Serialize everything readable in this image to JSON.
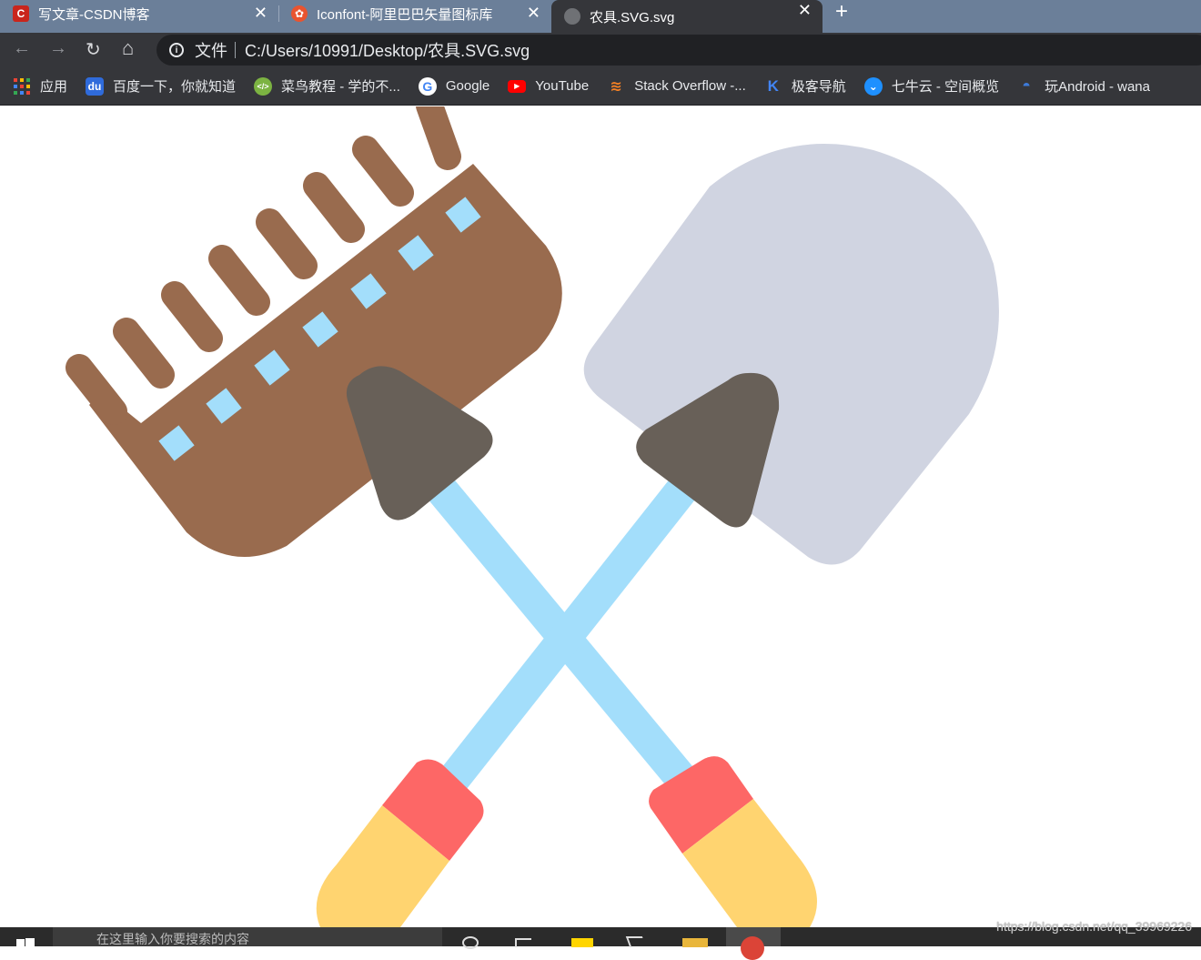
{
  "browser": {
    "tabs": [
      {
        "title": "写文章-CSDN博客",
        "favicon": "C",
        "favicon_color": "#c9251c",
        "active": false
      },
      {
        "title": "Iconfont-阿里巴巴矢量图标库",
        "favicon": "✿",
        "favicon_color": "#e9542f",
        "active": false
      },
      {
        "title": "农具.SVG.svg",
        "favicon": "globe-icon",
        "favicon_color": "#6f7175",
        "active": true
      }
    ],
    "close_glyph": "✕",
    "new_tab_glyph": "+",
    "address_bar": {
      "info_glyph": "i",
      "origin_label": "文件",
      "url": "C:/Users/10991/Desktop/农具.SVG.svg"
    },
    "nav": {
      "back": "←",
      "forward": "→",
      "reload": "↻",
      "home": "⌂"
    },
    "bookmarks": [
      {
        "label": "应用",
        "icon": "apps-grid-icon",
        "color": "#4285f4"
      },
      {
        "label": "百度一下，你就知道",
        "icon": "baidu-paw-icon",
        "color": "#2f6bdb"
      },
      {
        "label": "菜鸟教程 - 学的不...",
        "icon": "runoob-icon",
        "color": "#7cb342"
      },
      {
        "label": "Google",
        "icon": "google-g-icon",
        "color": "#ffffff"
      },
      {
        "label": "YouTube",
        "icon": "youtube-play-icon",
        "color": "#ff0000"
      },
      {
        "label": "Stack Overflow -...",
        "icon": "stackoverflow-icon",
        "color": "#f48024"
      },
      {
        "label": "极客导航",
        "icon": "jike-icon",
        "color": "#4285f4"
      },
      {
        "label": "七牛云 - 空间概览",
        "icon": "qiniu-icon",
        "color": "#1e90ff"
      },
      {
        "label": "玩Android - wana",
        "icon": "android-icon",
        "color": "#3d7bd9"
      }
    ]
  },
  "illustration": {
    "name": "farm-tools-rake-and-shovel",
    "colors": {
      "rake_head": "#996b4e",
      "rake_slots": "#a3defb",
      "shovel_blade": "#d0d4e1",
      "socket": "#686058",
      "handle": "#a3defb",
      "grip_band": "#fd6766",
      "grip_end": "#ffd470"
    }
  },
  "taskbar": {
    "search_placeholder": "在这里输入你要搜索的内容"
  },
  "watermark": "https://blog.csdn.net/qq_39969226"
}
